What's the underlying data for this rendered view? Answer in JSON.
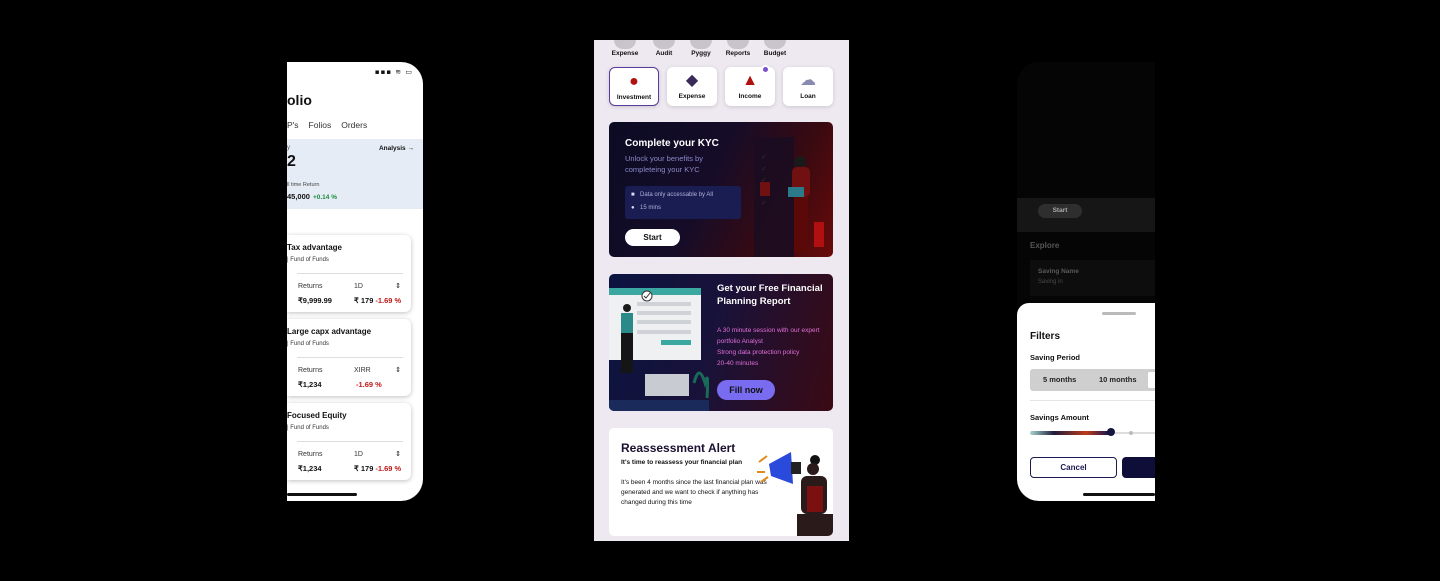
{
  "left_phone": {
    "status_icons": "▪▪▪ ≋ ▭",
    "title": "olio",
    "tabs": [
      "P's",
      "Folios",
      "Orders"
    ],
    "summary": {
      "label": "y",
      "analysis": "Analysis",
      "big_value": "2",
      "alltime_label": "ll time Return",
      "return_value": "45,000",
      "return_change": "+0.14 %"
    },
    "funds": [
      {
        "name": "Tax advantage",
        "sub": "| Fund of Funds",
        "col1": "Returns",
        "col2": "1D",
        "val1": "₹9,999.99",
        "val2": "₹ 179",
        "change": "-1.69 %"
      },
      {
        "name": "Large capx advantage",
        "sub": "| Fund of Funds",
        "col1": "Returns",
        "col2": "XIRR",
        "val1": "₹1,234",
        "val2": "",
        "change": "-1.69 %"
      },
      {
        "name": "Focused Equity",
        "sub": "| Fund of Funds",
        "col1": "Returns",
        "col2": "1D",
        "val1": "₹1,234",
        "val2": "₹ 179",
        "change": "-1.69 %"
      }
    ]
  },
  "center": {
    "nav": [
      "Expense",
      "Audit",
      "Pyggy",
      "Reports",
      "Budget"
    ],
    "categories": [
      {
        "label": "Investment",
        "icon": "investment-icon"
      },
      {
        "label": "Expense",
        "icon": "expense-icon"
      },
      {
        "label": "Income",
        "icon": "income-icon"
      },
      {
        "label": "Loan",
        "icon": "loan-icon"
      }
    ],
    "kyc": {
      "title": "Complete your KYC",
      "subtitle": "Unlock your benefits by completeing your KYC",
      "info_1": "Data only accessable by All",
      "info_2": "15 mins",
      "start": "Start",
      "checks": "✓\n✓\n✓\n✓\n✓"
    },
    "financial": {
      "title": "Get your Free Financial Planning Report",
      "desc_1": "A 30 minute session with our expert portfolio Analyst",
      "desc_2": "Strong data protection policy",
      "desc_3": "20-40 minutes",
      "button": "Fill now"
    },
    "reassessment": {
      "title": "Reassessment Alert",
      "subtitle": "It's time to reassess your financial plan",
      "body": "It's been 4 months since the last financial plan was generated and we want to check if anything has changed during this time"
    }
  },
  "right_phone": {
    "start": "Start",
    "explore": "Explore",
    "saving_name": "Saving Name",
    "saving_sub": "Saving in",
    "filters": "Filters",
    "saving_period": "Saving Period",
    "period_options": [
      "5 months",
      "10 months"
    ],
    "savings_amount": "Savings Amount",
    "cancel": "Cancel",
    "amount_level": 0.64
  },
  "colors": {
    "accent_purple": "#7a6cf0",
    "negative": "#c01818",
    "positive": "#1a8a3a",
    "navy": "#0e0e38"
  }
}
